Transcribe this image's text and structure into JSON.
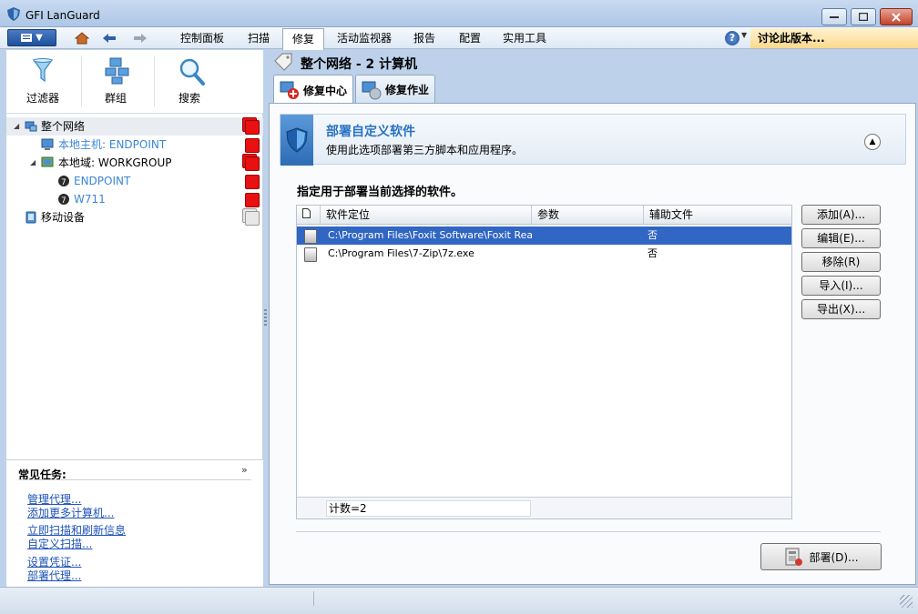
{
  "window": {
    "title": "GFI LanGuard"
  },
  "menu": {
    "items": [
      "控制面板",
      "扫描",
      "修复",
      "活动监视器",
      "报告",
      "配置",
      "实用工具"
    ],
    "discuss_label": "讨论此版本..."
  },
  "toolbar": {
    "filter": "过滤器",
    "group": "群组",
    "search": "搜索"
  },
  "tree": {
    "root": "整个网络",
    "localhost": "本地主机: ENDPOINT",
    "domain": "本地域: WORKGROUP",
    "machine1": "ENDPOINT",
    "machine2": "W711",
    "mobile": "移动设备"
  },
  "tasks": {
    "title": "常见任务:",
    "items": [
      "管理代理...",
      "添加更多计算机...",
      "立即扫描和刷新信息",
      "自定义扫描...",
      "设置凭证...",
      "部署代理..."
    ]
  },
  "page": {
    "title": "整个网络 - 2 计算机",
    "tabs": [
      "修复中心",
      "修复作业"
    ]
  },
  "banner": {
    "title": "部署自定义软件",
    "subtitle": "使用此选项部署第三方脚本和应用程序。"
  },
  "section": {
    "title": "指定用于部署当前选择的软件。"
  },
  "grid": {
    "columns": [
      "软件定位",
      "参数",
      "辅助文件"
    ],
    "rows": [
      {
        "path": "C:\\Program Files\\Foxit Software\\Foxit Rea...",
        "params": "",
        "aux": "否"
      },
      {
        "path": "C:\\Program Files\\7-Zip\\7z.exe",
        "params": "",
        "aux": "否"
      }
    ],
    "count": "计数=2"
  },
  "buttons": {
    "add": "添加(A)...",
    "edit": "编辑(E)...",
    "remove": "移除(R)",
    "import": "导入(I)...",
    "export": "导出(X)...",
    "deploy": "部署(D)..."
  },
  "colors": {
    "selection": "#3166c4",
    "banner_title": "#2772c3",
    "status_red": "#e81010"
  }
}
